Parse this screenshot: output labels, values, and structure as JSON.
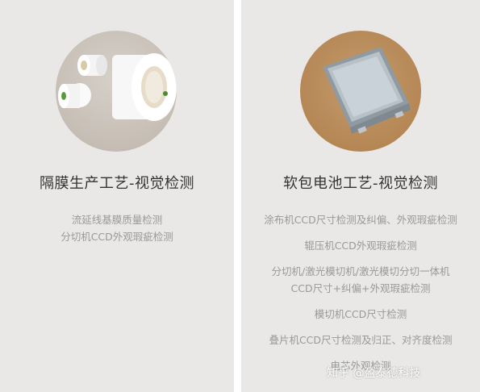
{
  "left_card": {
    "title": "隔膜生产工艺-视觉检测",
    "items": [
      "流延线基膜质量检测",
      "分切机CCD外观瑕疵检测"
    ]
  },
  "right_card": {
    "title": "软包电池工艺-视觉检测",
    "items": [
      [
        "涂布机CCD尺寸检测及纠偏、外观瑕疵检测"
      ],
      [
        "辊压机CCD外观瑕疵检测"
      ],
      [
        "分切机/激光模切机/激光模切分切一体机",
        "CCD尺寸+纠偏+外观瑕疵检测"
      ],
      [
        "模切机CCD尺寸检测"
      ],
      [
        "叠片机CCD尺寸检测及归正、对齐度检测"
      ],
      [
        "电芯外观检测"
      ]
    ]
  },
  "watermark": "知乎 @盈泰德科技"
}
